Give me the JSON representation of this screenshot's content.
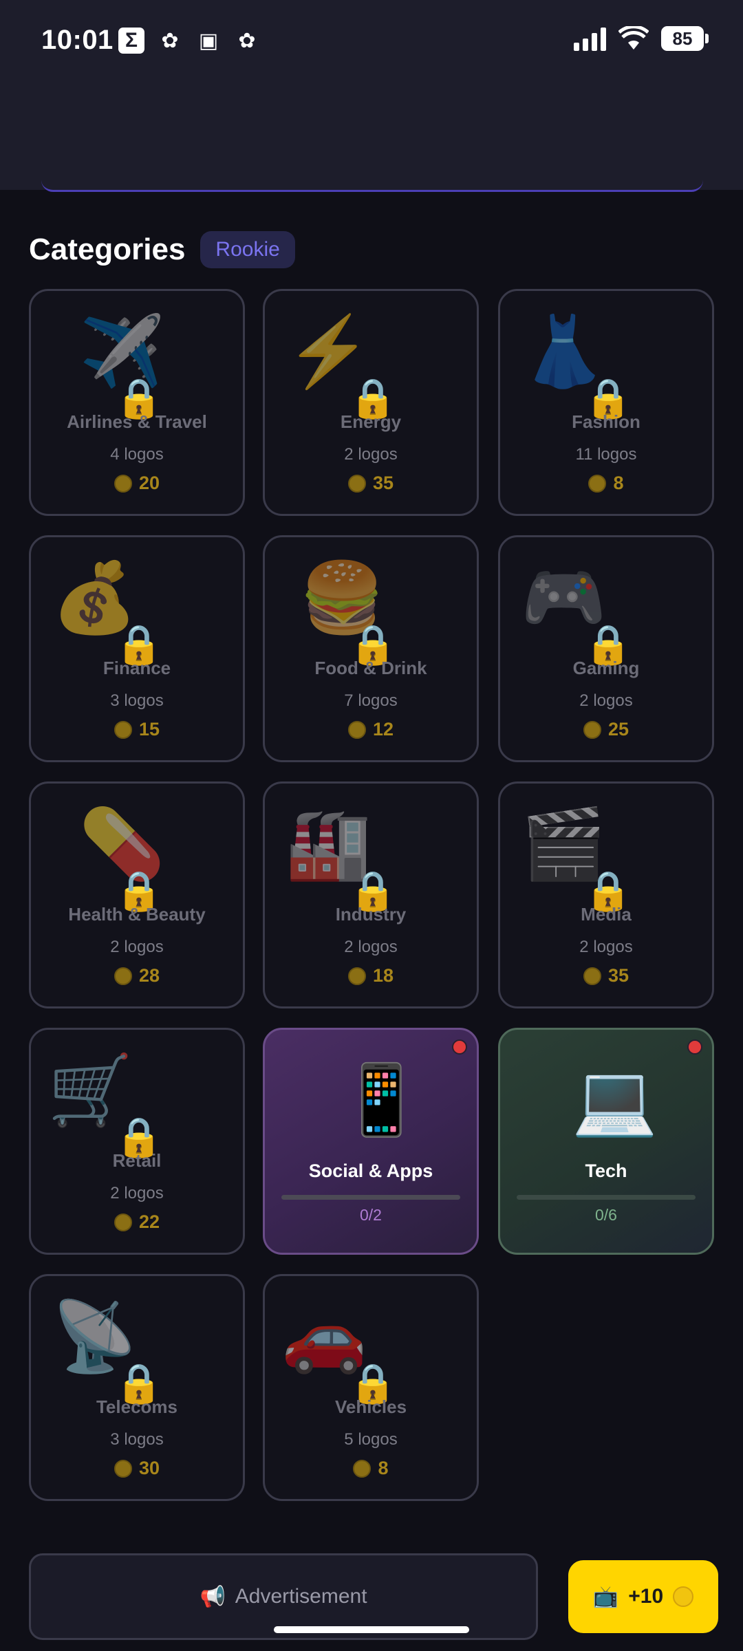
{
  "status_bar": {
    "time": "10:01",
    "battery": "85"
  },
  "categories_title": "Categories",
  "level_badge": "Rookie",
  "locked_categories": [
    {
      "name": "Airlines & Travel",
      "count": "4 logos",
      "price": "20",
      "emoji": "✈️"
    },
    {
      "name": "Energy",
      "count": "2 logos",
      "price": "35",
      "emoji": "⚡"
    },
    {
      "name": "Fashion",
      "count": "11 logos",
      "price": "8",
      "emoji": "👗"
    },
    {
      "name": "Finance",
      "count": "3 logos",
      "price": "15",
      "emoji": "💰"
    },
    {
      "name": "Food & Drink",
      "count": "7 logos",
      "price": "12",
      "emoji": "🍔"
    },
    {
      "name": "Gaming",
      "count": "2 logos",
      "price": "25",
      "emoji": "🎮"
    },
    {
      "name": "Health & Beauty",
      "count": "2 logos",
      "price": "28",
      "emoji": "💊"
    },
    {
      "name": "Industry",
      "count": "2 logos",
      "price": "18",
      "emoji": "🏭"
    },
    {
      "name": "Media",
      "count": "2 logos",
      "price": "35",
      "emoji": "🎬"
    },
    {
      "name": "Retail",
      "count": "2 logos",
      "price": "22",
      "emoji": "🛒"
    },
    {
      "name": "Telecoms",
      "count": "3 logos",
      "price": "30",
      "emoji": "📡"
    },
    {
      "name": "Vehicles",
      "count": "5 logos",
      "price": "8",
      "emoji": "🚗"
    }
  ],
  "unlocked_categories": [
    {
      "name": "Social & Apps",
      "progress": "0/2",
      "emoji": "📱"
    },
    {
      "name": "Tech",
      "progress": "0/6",
      "emoji": "💻"
    }
  ],
  "ad": {
    "icon": "📢",
    "label": "Advertisement"
  },
  "reward_button": {
    "tv_icon": "📺",
    "label": "+10"
  }
}
